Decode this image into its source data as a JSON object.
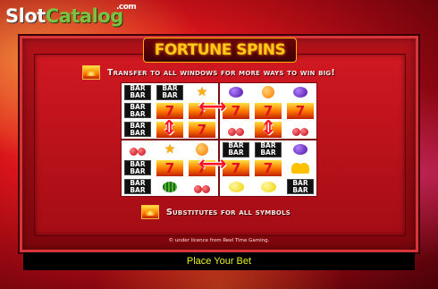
{
  "watermark": {
    "slot": "Slot",
    "catalog": "Catalog",
    "com": ".com"
  },
  "title": "FORTUNE SPINS",
  "info": {
    "transfer_text": "Transfer to all windows for more ways to win big!",
    "substitutes_text": "Substitutes for all symbols",
    "icon": "fortune-seven-wild-icon"
  },
  "grid": {
    "windows": [
      [
        [
          "BAR",
          "BAR",
          "star"
        ],
        [
          "BAR",
          "seven",
          "seven"
        ],
        [
          "BAR",
          "seven",
          "seven"
        ]
      ],
      [
        [
          "plum",
          "orange",
          "plum"
        ],
        [
          "seven",
          "seven",
          "seven"
        ],
        [
          "cherry",
          "seven",
          "cherry"
        ]
      ],
      [
        [
          "cherry",
          "star",
          "orange"
        ],
        [
          "BAR",
          "seven",
          "seven"
        ],
        [
          "BAR",
          "melon",
          "cherry"
        ]
      ],
      [
        [
          "BAR",
          "BAR",
          "plum"
        ],
        [
          "seven",
          "seven",
          "bell"
        ],
        [
          "lemon",
          "lemon",
          "BAR"
        ]
      ]
    ],
    "arrows": [
      "left-right-arrow",
      "left-right-arrow",
      "up-down-arrow",
      "up-down-arrow"
    ]
  },
  "fine_print": "© under licence from Reel Time Gaming.",
  "bottom": {
    "place_bet": "Place Your Bet"
  },
  "colors": {
    "title": "#ffcc1a",
    "place_bet": "#e8f020",
    "arrow": "#ff1020"
  }
}
